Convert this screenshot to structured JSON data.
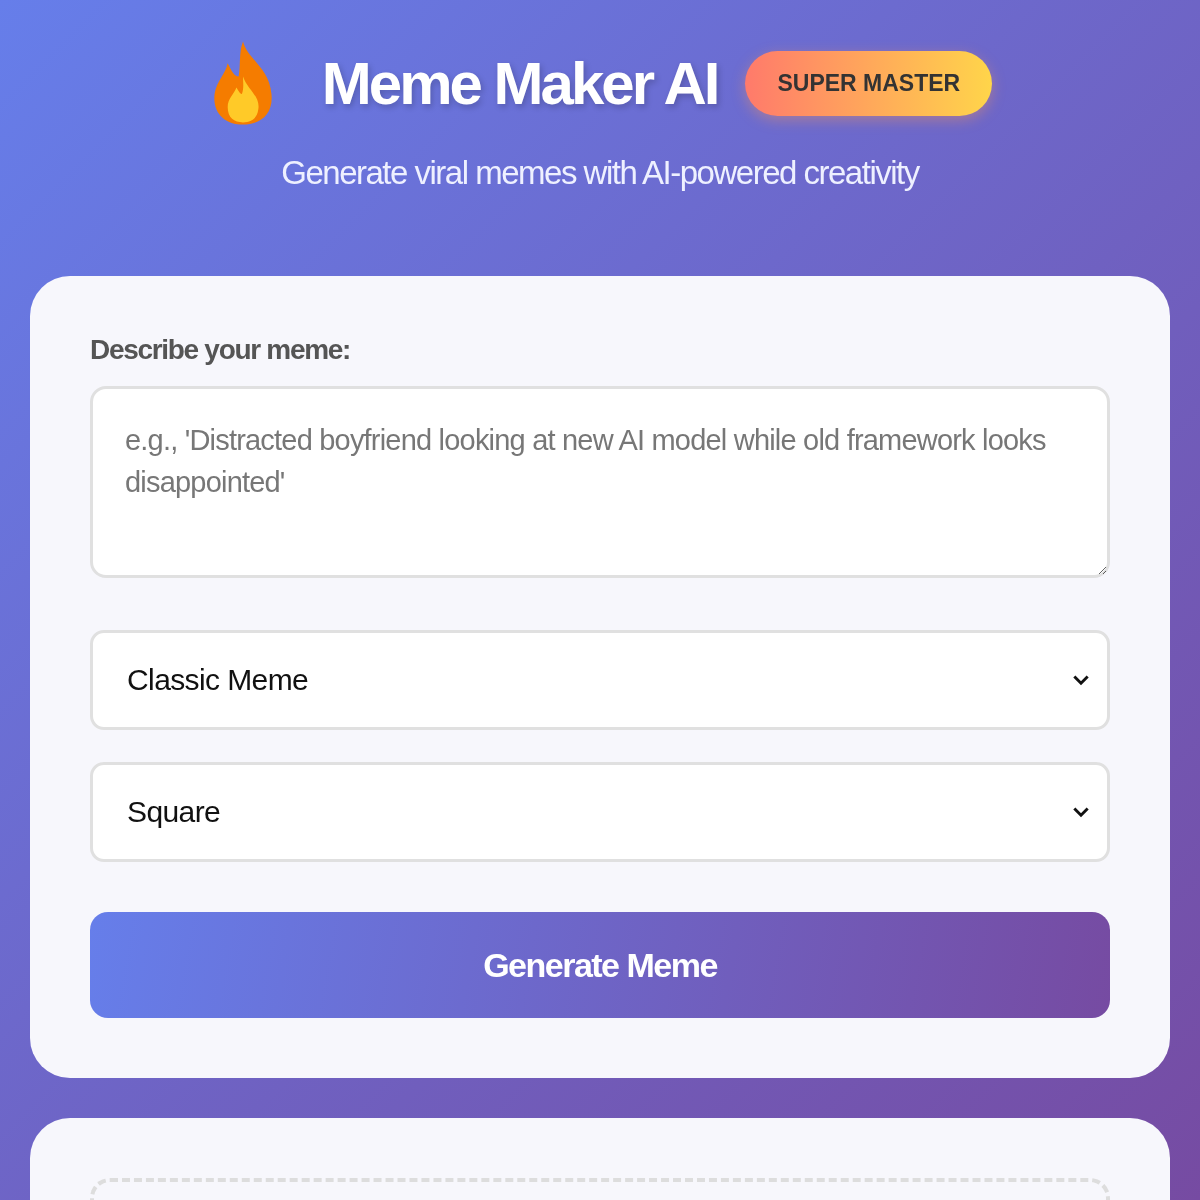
{
  "header": {
    "title": "Meme Maker AI",
    "badge": "SUPER MASTER",
    "subtitle": "Generate viral memes with AI-powered creativity"
  },
  "form": {
    "label": "Describe your meme:",
    "prompt": {
      "placeholder": "e.g., 'Distracted boyfriend looking at new AI model while old framework looks disappointed'"
    },
    "selects": [
      {
        "value": "Classic Meme"
      },
      {
        "value": "Square"
      }
    ],
    "button": "Generate Meme"
  }
}
